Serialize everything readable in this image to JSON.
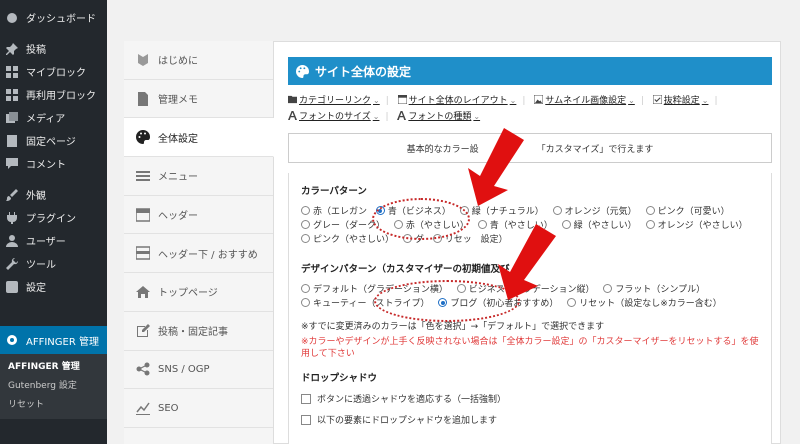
{
  "wp_menu": {
    "items": [
      {
        "label": "ダッシュボード",
        "icon": "dashboard-icon"
      },
      {
        "label": "投稿",
        "icon": "pin-icon"
      },
      {
        "label": "マイブロック",
        "icon": "grid-icon"
      },
      {
        "label": "再利用ブロック",
        "icon": "grid-icon"
      },
      {
        "label": "メディア",
        "icon": "media-icon"
      },
      {
        "label": "固定ページ",
        "icon": "page-icon"
      },
      {
        "label": "コメント",
        "icon": "comment-icon"
      },
      {
        "label": "外観",
        "icon": "brush-icon"
      },
      {
        "label": "プラグイン",
        "icon": "plugin-icon"
      },
      {
        "label": "ユーザー",
        "icon": "user-icon"
      },
      {
        "label": "ツール",
        "icon": "wrench-icon"
      },
      {
        "label": "設定",
        "icon": "settings-icon"
      }
    ],
    "active": {
      "label": "AFFINGER 管理",
      "icon": "gear-icon"
    },
    "submenu": [
      "AFFINGER 管理",
      "Gutenberg 設定",
      "リセット"
    ]
  },
  "plugin_tabs": [
    {
      "label": "はじめに",
      "icon": "beginner-icon"
    },
    {
      "label": "管理メモ",
      "icon": "memo-icon"
    },
    {
      "label": "全体設定",
      "icon": "palette-icon"
    },
    {
      "label": "メニュー",
      "icon": "menu-icon"
    },
    {
      "label": "ヘッダー",
      "icon": "header-icon"
    },
    {
      "label": "ヘッダー下 / おすすめ",
      "icon": "header-below-icon"
    },
    {
      "label": "トップページ",
      "icon": "home-icon"
    },
    {
      "label": "投稿・固定記事",
      "icon": "edit-icon"
    },
    {
      "label": "SNS / OGP",
      "icon": "share-icon"
    },
    {
      "label": "SEO",
      "icon": "chart-icon"
    }
  ],
  "main": {
    "title": "サイト全体の設定",
    "links_row1": [
      "カテゴリーリンク",
      "サイト全体のレイアウト",
      "サムネイル画像設定",
      "抜粋設定"
    ],
    "links_row2": [
      "フォントのサイズ",
      "フォントの種類"
    ],
    "info_left": "基本的なカラー設",
    "info_right": "「カスタマイズ」で行えます"
  },
  "color_pattern": {
    "title": "カラーパターン",
    "options": [
      {
        "label": "赤（エレガン",
        "checked": false
      },
      {
        "label": "青（ビジネス）",
        "checked": true
      },
      {
        "label": "緑（ナチュラル）",
        "checked": false
      },
      {
        "label": "オレンジ（元気）",
        "checked": false
      },
      {
        "label": "ピンク（可愛い）",
        "checked": false
      },
      {
        "label": "グレー（ダーク）",
        "checked": false
      },
      {
        "label": "赤（やさしい）",
        "checked": false
      },
      {
        "label": "青（やさしい）",
        "checked": false
      },
      {
        "label": "緑（やさしい）",
        "checked": false
      },
      {
        "label": "オレンジ（やさしい）",
        "checked": false
      },
      {
        "label": "ピンク（やさしい）",
        "checked": false
      },
      {
        "label": "グ",
        "checked": false
      },
      {
        "label": "リセッ",
        "checked": false
      }
    ],
    "trailing": "設定）"
  },
  "design_pattern": {
    "title": "デザインパターン（カスタマイザーの初期値及び",
    "options": [
      {
        "label": "デフォルト（グラデーション横）",
        "checked": false
      },
      {
        "label": "ビジネス（グラデーション縦）",
        "checked": false
      },
      {
        "label": "フラット（シンプル）",
        "checked": false
      },
      {
        "label": "キューティー（ストライプ）",
        "checked": false
      },
      {
        "label": "ブログ（初心者おすすめ）",
        "checked": true
      },
      {
        "label": "リセット（設定なし※カラー含む）",
        "checked": false
      }
    ],
    "note": "※すでに変更済みのカラーは「色を選択」→「デフォルト」で選択できます",
    "warning": "※カラーやデザインが上手く反映されない場合は「全体カラー設定」の「カスターマイザーをリセットする」を使用して下さい"
  },
  "drop_shadow": {
    "title": "ドロップシャドウ",
    "options": [
      "ボタンに透過シャドウを適応する（一括強制）",
      "以下の要素にドロップシャドウを追加します"
    ]
  },
  "colors": {
    "accent": "#1f8fc9",
    "sidebar_bg": "#23282d",
    "menu_active": "#0073aa",
    "warning": "#e03a3a",
    "annotation": "#e01010"
  }
}
